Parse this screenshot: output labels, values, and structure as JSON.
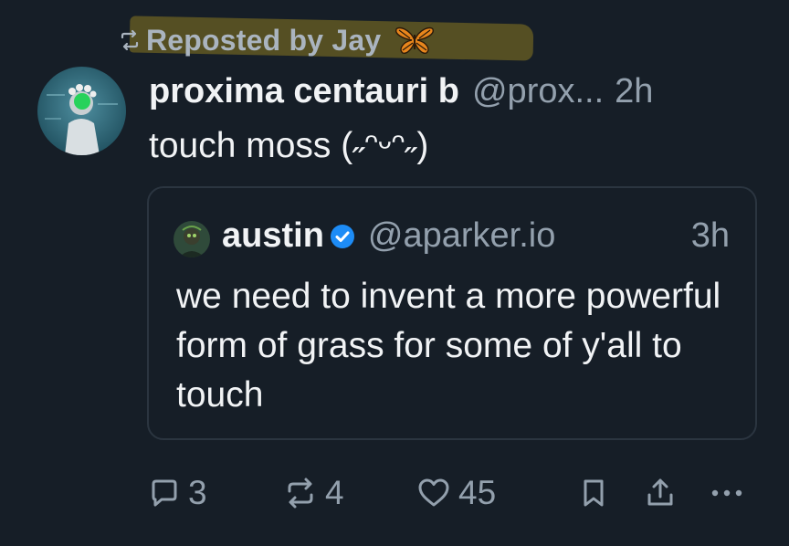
{
  "repost": {
    "label": "Reposted by Jay",
    "emoji_icon": "butterfly-icon",
    "highlight_color": "#5c5424"
  },
  "post": {
    "author_name": "proxima centauri b",
    "author_handle": "@prox...",
    "time": "2h",
    "text": "touch moss (˶ᵔᵕᵔ˶)"
  },
  "quote": {
    "author_name": "austin",
    "verified": true,
    "author_handle": "@aparker.io",
    "time": "3h",
    "text": "we need to invent a more powerful form of grass for some of y'all to touch"
  },
  "actions": {
    "reply_count": "3",
    "repost_count": "4",
    "like_count": "45"
  },
  "colors": {
    "background": "#161e27",
    "text": "#f1f3f5",
    "muted": "#93a0ad",
    "border": "#2b3540",
    "verified_blue": "#1d8cf6"
  }
}
